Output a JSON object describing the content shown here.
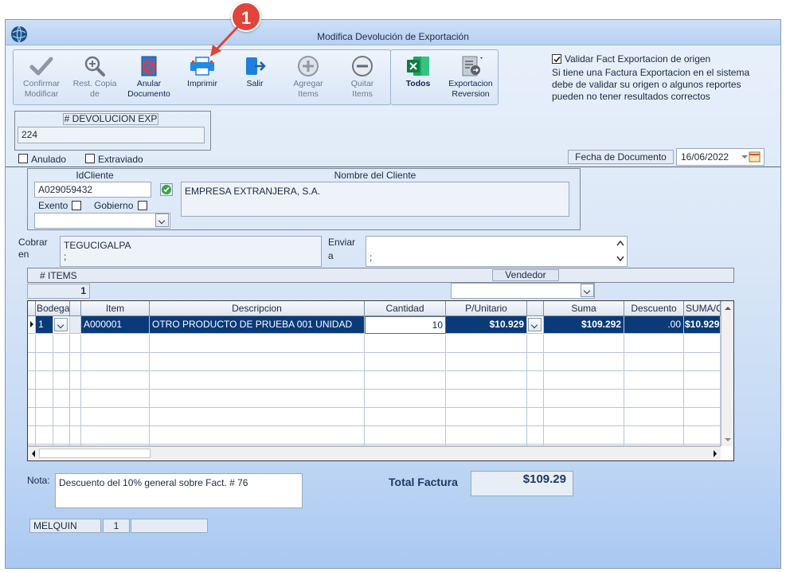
{
  "window": {
    "title": "Modifica Devolución de Exportación"
  },
  "annotation": {
    "badge": "1"
  },
  "toolbar": {
    "confirm_l1": "Confirmar",
    "confirm_l2": "Modificar",
    "restcopy_l1": "Rest. Copia",
    "restcopy_l2": "de",
    "anular_l1": "Anular",
    "anular_l2": "Documento",
    "imprimir": "Imprimir",
    "salir": "Salir",
    "agregar_l1": "Agregar",
    "agregar_l2": "Items",
    "quitar_l1": "Quitar",
    "quitar_l2": "Items",
    "todos": "Todos",
    "export_l1": "Exportacion",
    "export_l2": "Reversion"
  },
  "validation": {
    "checkbox_label": "Validar Fact Exportacion de origen",
    "checked": true,
    "note_l1": "Si tiene una Factura Exportacion en el sistema",
    "note_l2": "debe de validar su origen o algunos reportes",
    "note_l3": "pueden no tener resultados correctos"
  },
  "document": {
    "number_label": "# DEVOLUCION EXP",
    "number_value": "224",
    "anulado_label": "Anulado",
    "extraviado_label": "Extraviado",
    "date_label": "Fecha de  Documento",
    "date_value": "16/06/2022"
  },
  "client": {
    "id_label": "IdCliente",
    "id_value": "A029059432",
    "name_label": "Nombre del Cliente",
    "name_value": "EMPRESA EXTRANJERA, S.A.",
    "exento_label": "Exento",
    "gobierno_label": "Gobierno"
  },
  "address": {
    "cobrar_l1": "Cobrar",
    "cobrar_l2": "en",
    "cobrar_value_l1": "TEGUCIGALPA",
    "cobrar_value_l2": ";",
    "enviar_l1": "Enviar",
    "enviar_l2": "a",
    "enviar_value": ";"
  },
  "items_bar": {
    "items_label": "# ITEMS",
    "items_count": "1",
    "vendedor_label": "Vendedor"
  },
  "grid": {
    "columns": {
      "bodega": "Bodega",
      "item": "Item",
      "descripcion": "Descripcion",
      "cantidad": "Cantidad",
      "punitario": "P/Unitario",
      "suma": "Suma",
      "descuento": "Descuento",
      "sumac": "SUMA/C"
    },
    "rows": [
      {
        "bodega": "1",
        "item": "A000001",
        "descripcion": "OTRO PRODUCTO DE PRUEBA 001 UNIDAD",
        "cantidad": "10",
        "punitario": "$10.929",
        "suma": "$109.292",
        "descuento": ".00",
        "sumac": "$10.929"
      }
    ]
  },
  "footer": {
    "nota_label": "Nota:",
    "nota_value": "Descuento del 10% general sobre Fact. # 76",
    "total_label": "Total Factura",
    "total_value": "$109.29",
    "status_user": "MELQUIN",
    "status_num": "1",
    "status_extra": ""
  },
  "colors": {
    "accent": "#0b3a78",
    "badge": "#e0443b",
    "title_bar": "#b7d0f1"
  }
}
